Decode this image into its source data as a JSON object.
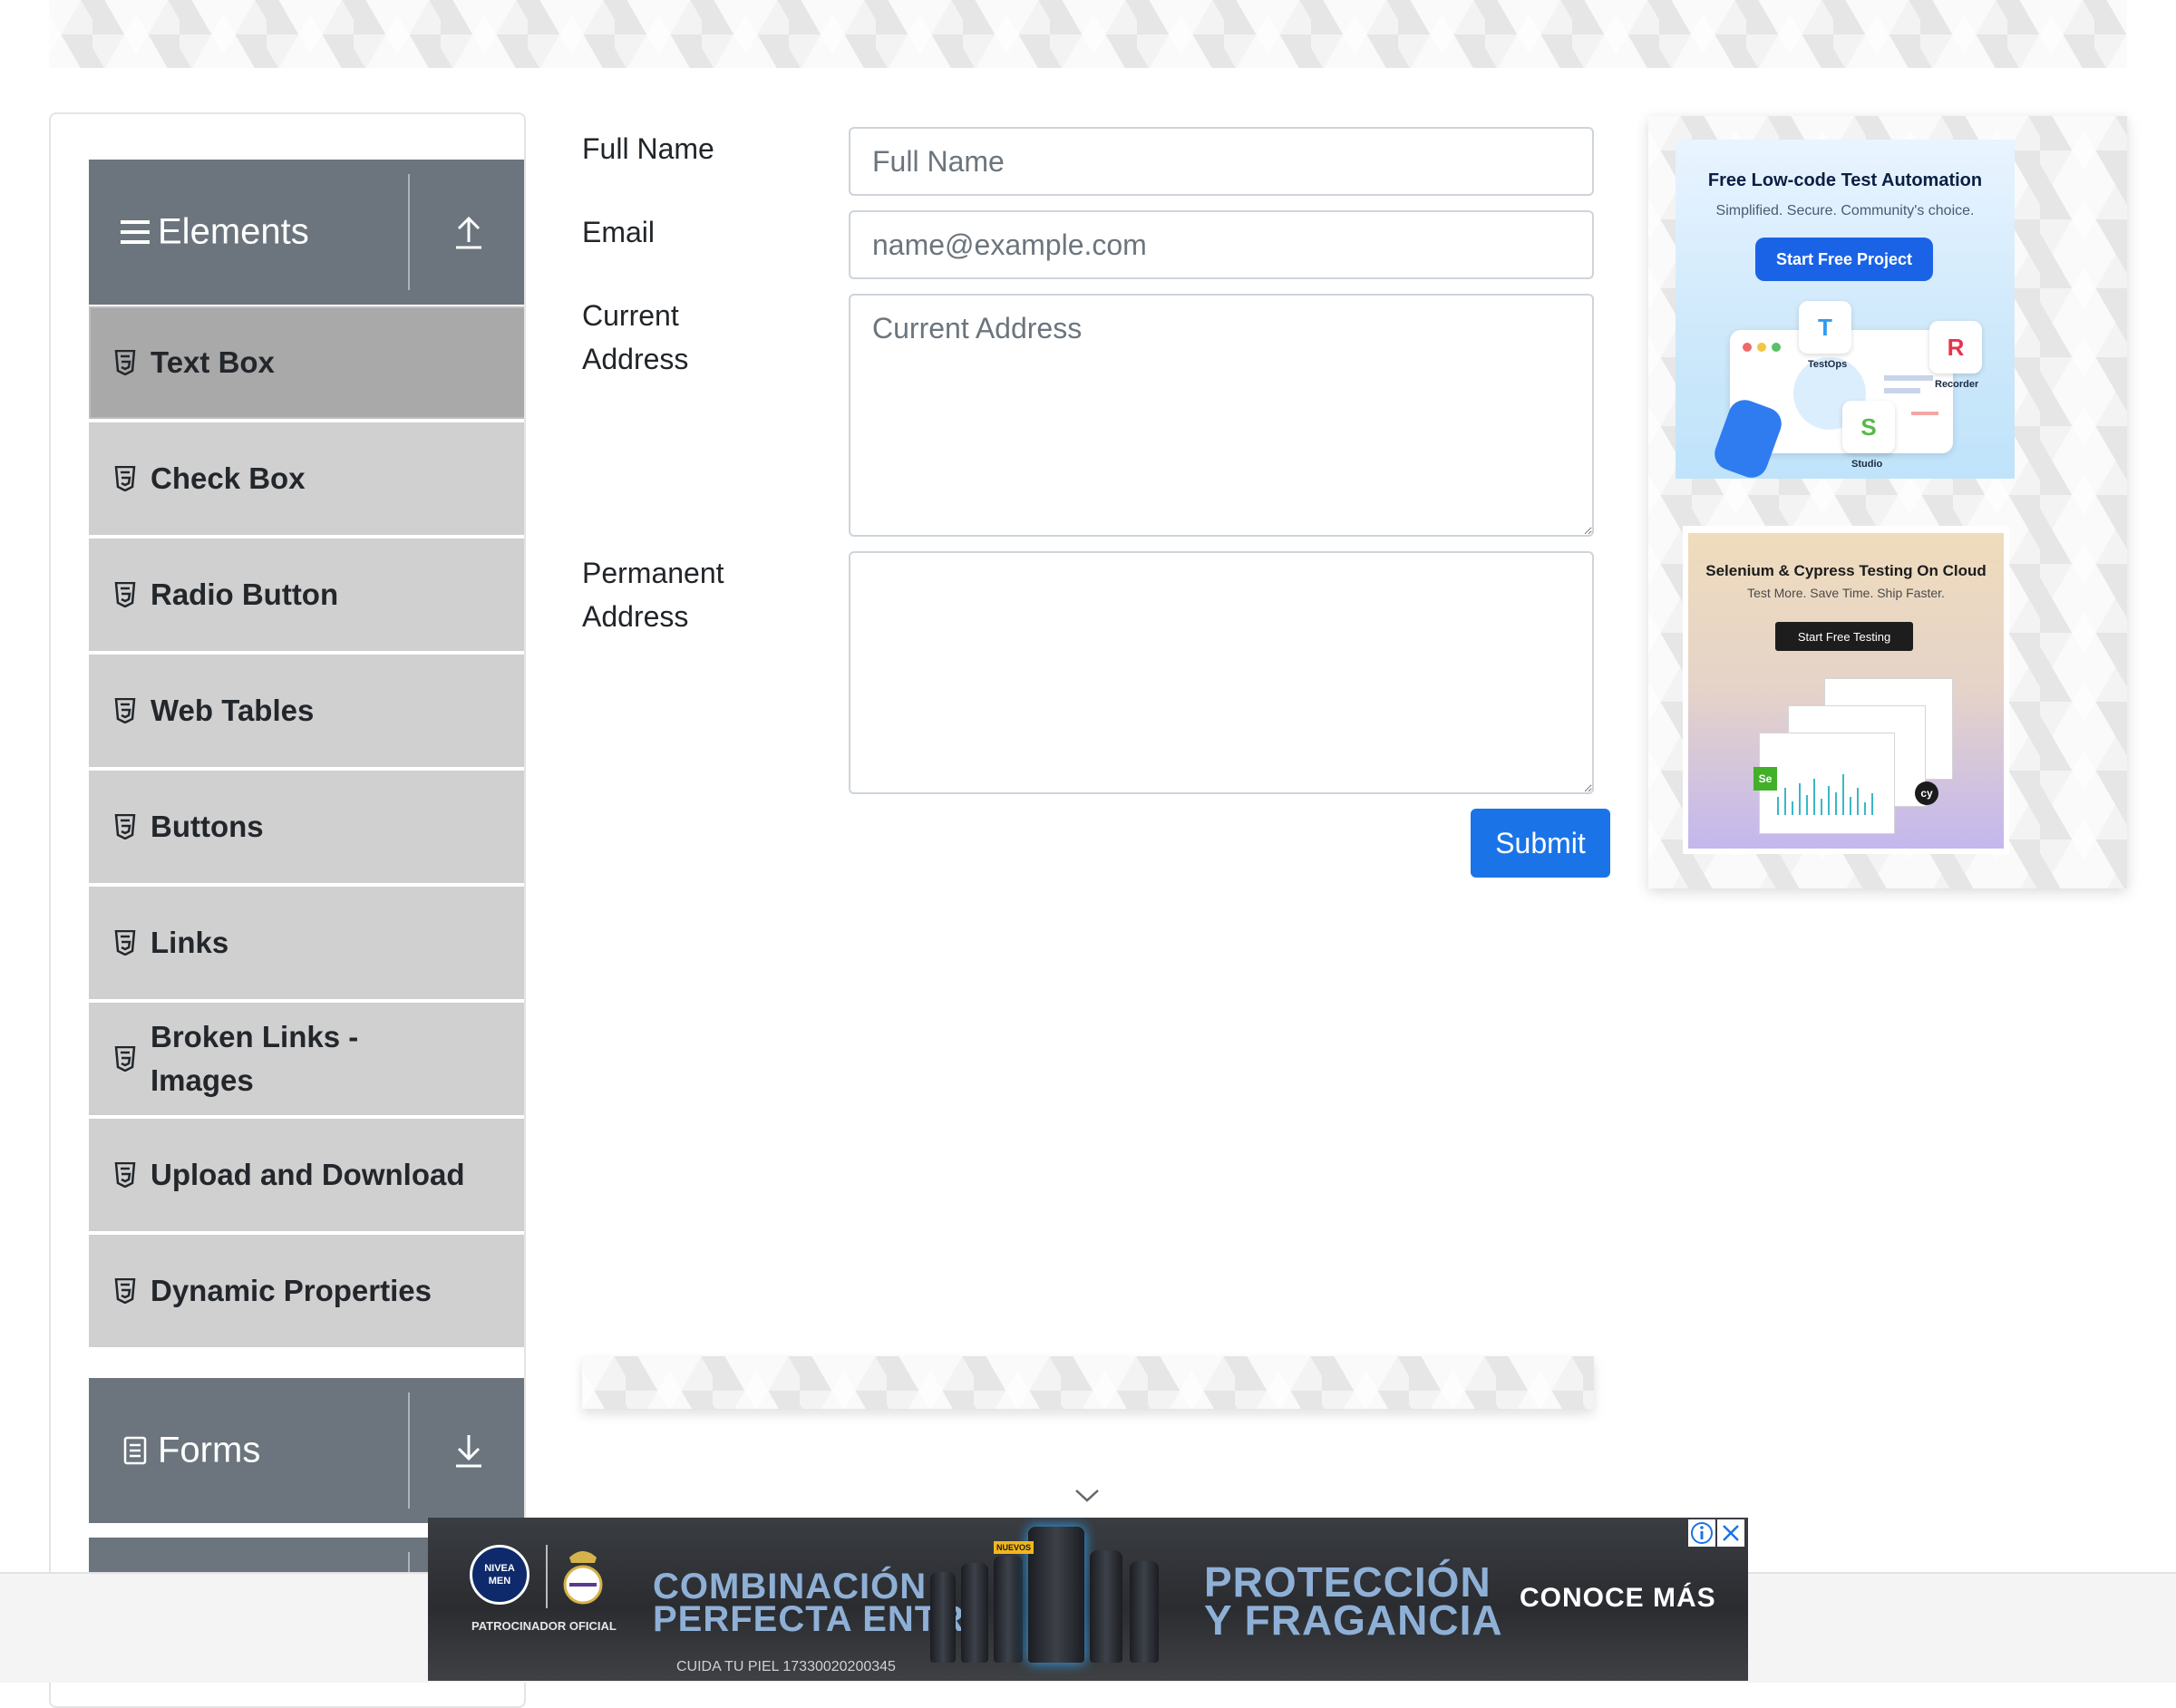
{
  "sidebar": {
    "groups": [
      {
        "title": "Elements",
        "expanded": true
      },
      {
        "title": "Forms",
        "expanded": false
      }
    ],
    "items": [
      {
        "label": "Text Box",
        "active": true
      },
      {
        "label": "Check Box"
      },
      {
        "label": "Radio Button"
      },
      {
        "label": "Web Tables"
      },
      {
        "label": "Buttons"
      },
      {
        "label": "Links"
      },
      {
        "label": "Broken Links - Images"
      },
      {
        "label": "Upload and Download"
      },
      {
        "label": "Dynamic Properties"
      }
    ]
  },
  "form": {
    "full_name": {
      "label": "Full Name",
      "placeholder": "Full Name",
      "value": ""
    },
    "email": {
      "label": "Email",
      "placeholder": "name@example.com",
      "value": ""
    },
    "current_address": {
      "label": "Current Address",
      "placeholder": "Current Address",
      "value": ""
    },
    "permanent_address": {
      "label": "Permanent Address",
      "placeholder": "",
      "value": ""
    },
    "submit_label": "Submit"
  },
  "ads": {
    "ad1": {
      "title": "Free Low-code Test Automation",
      "subtitle": "Simplified. Secure. Community's choice.",
      "cta": "Start Free Project",
      "tiles": [
        {
          "letter": "T",
          "caption": "TestOps"
        },
        {
          "letter": "R",
          "caption": "Recorder"
        },
        {
          "letter": "S",
          "caption": "Studio"
        }
      ]
    },
    "ad2": {
      "title": "Selenium & Cypress Testing On Cloud",
      "subtitle": "Test More. Save Time. Ship Faster.",
      "cta": "Start Free Testing",
      "badge_se": "Se",
      "badge_cy": "cy"
    },
    "bottom": {
      "brand": "NIVEA MEN",
      "sponsor": "PATROCINADOR OFICIAL",
      "headline_left_1": "COMBINACIÓN",
      "headline_left_2": "PERFECTA ENTRE",
      "headline_right_1": "PROTECCIÓN",
      "headline_right_2": "Y FRAGANCIA",
      "cta": "CONOCE MÁS",
      "fine_print": "CUIDA TU PIEL 17330020200345",
      "bottle_tag": "NUEVOS"
    }
  },
  "colors": {
    "sidebar_header": "#6c757d",
    "menu_item": "#d0d0d0",
    "menu_item_active": "#a9a9a9",
    "primary": "#1a74e8"
  }
}
